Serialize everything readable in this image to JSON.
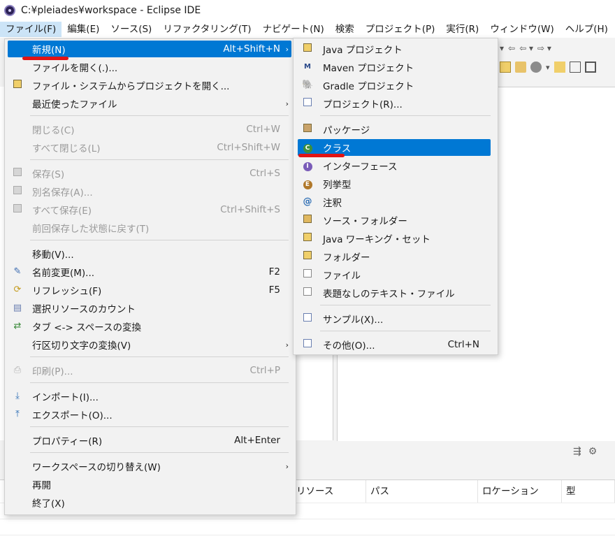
{
  "window": {
    "title": "C:¥pleiades¥workspace - Eclipse IDE"
  },
  "menubar": [
    "ファイル(F)",
    "編集(E)",
    "ソース(S)",
    "リファクタリング(T)",
    "ナビゲート(N)",
    "検索",
    "プロジェクト(P)",
    "実行(R)",
    "ウィンドウ(W)",
    "ヘルプ(H)"
  ],
  "file_menu": {
    "items": [
      {
        "label": "新規(N)",
        "accel": "Alt+Shift+N",
        "submenu": true,
        "highlighted": true
      },
      {
        "label": "ファイルを開く(.)..."
      },
      {
        "label": "ファイル・システムからプロジェクトを開く...",
        "icon": "folder-icon"
      },
      {
        "label": "最近使ったファイル",
        "submenu": true
      },
      {
        "label": "閉じる(C)",
        "accel": "Ctrl+W",
        "disabled": true
      },
      {
        "label": "すべて閉じる(L)",
        "accel": "Ctrl+Shift+W",
        "disabled": true
      },
      {
        "label": "保存(S)",
        "accel": "Ctrl+S",
        "disabled": true,
        "icon": "save-icon"
      },
      {
        "label": "別名保存(A)...",
        "disabled": true,
        "icon": "save-as-icon"
      },
      {
        "label": "すべて保存(E)",
        "accel": "Ctrl+Shift+S",
        "disabled": true,
        "icon": "save-all-icon"
      },
      {
        "label": "前回保存した状態に戻す(T)",
        "disabled": true
      },
      {
        "label": "移動(V)..."
      },
      {
        "label": "名前変更(M)...",
        "accel": "F2",
        "icon": "rename-icon"
      },
      {
        "label": "リフレッシュ(F)",
        "accel": "F5",
        "icon": "refresh-icon"
      },
      {
        "label": "選択リソースのカウント",
        "icon": "count-icon"
      },
      {
        "label": "タブ <-> スペースの変換",
        "icon": "convert-icon"
      },
      {
        "label": "行区切り文字の変換(V)",
        "submenu": true
      },
      {
        "label": "印刷(P)...",
        "accel": "Ctrl+P",
        "disabled": true,
        "icon": "print-icon"
      },
      {
        "label": "インポート(I)...",
        "icon": "import-icon"
      },
      {
        "label": "エクスポート(O)...",
        "icon": "export-icon"
      },
      {
        "label": "プロパティー(R)",
        "accel": "Alt+Enter"
      },
      {
        "label": "ワークスペースの切り替え(W)",
        "submenu": true
      },
      {
        "label": "再開"
      },
      {
        "label": "終了(X)"
      }
    ]
  },
  "new_menu": {
    "items": [
      {
        "label": "Java プロジェクト",
        "icon": "java-project-icon"
      },
      {
        "label": "Maven プロジェクト",
        "icon": "maven-icon"
      },
      {
        "label": "Gradle プロジェクト",
        "icon": "gradle-icon"
      },
      {
        "label": "プロジェクト(R)...",
        "icon": "project-icon"
      },
      {
        "label": "パッケージ",
        "icon": "package-icon"
      },
      {
        "label": "クラス",
        "icon": "class-icon",
        "highlighted": true
      },
      {
        "label": "インターフェース",
        "icon": "interface-icon"
      },
      {
        "label": "列挙型",
        "icon": "enum-icon"
      },
      {
        "label": "注釈",
        "icon": "annotation-icon"
      },
      {
        "label": "ソース・フォルダー",
        "icon": "source-folder-icon"
      },
      {
        "label": "Java ワーキング・セット",
        "icon": "working-set-icon"
      },
      {
        "label": "フォルダー",
        "icon": "folder-icon"
      },
      {
        "label": "ファイル",
        "icon": "file-icon"
      },
      {
        "label": "表題なしのテキスト・ファイル",
        "icon": "text-file-icon"
      },
      {
        "label": "サンプル(X)...",
        "icon": "sample-icon"
      },
      {
        "label": "その他(O)...",
        "accel": "Ctrl+N",
        "icon": "other-icon"
      }
    ]
  },
  "problems_view": {
    "columns": [
      "リソース",
      "パス",
      "ロケーション",
      "型"
    ]
  },
  "colors": {
    "highlight": "#0078d4",
    "annotation_mark": "#e11414",
    "menu_bg": "#f2f2f2"
  }
}
